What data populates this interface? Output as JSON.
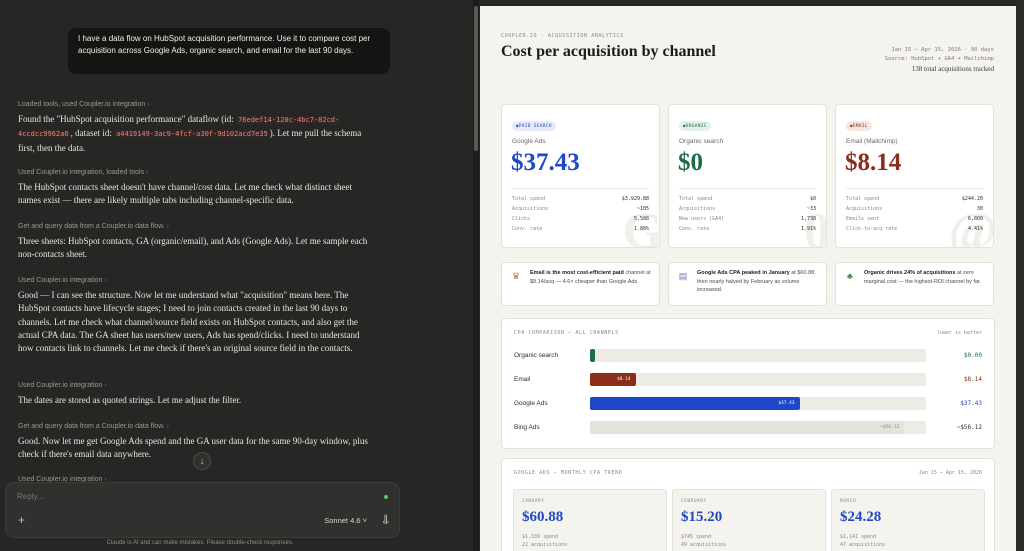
{
  "chat": {
    "user_message": "I have a data flow on HubSpot acquisition performance. Use it to compare cost per acquisition across Google Ads, organic search, and email for the last 90 days.",
    "step1": "Loaded tools, used Coupler.io integration",
    "para1_a": "Found the \"HubSpot acquisition performance\" dataflow (id: ",
    "para1_id": "76edef14-120c-4bc7-82cd-4ccdcc9962a6",
    "para1_b": ", dataset id: ",
    "para1_ds": "a4419149-3ac9-4fcf-a30f-9d102acd7e35",
    "para1_c": "). Let me pull the schema first, then the data.",
    "step2": "Used Coupler.io integration, loaded tools",
    "para2": "The HubSpot contacts sheet doesn't have channel/cost data. Let me check what distinct sheet names exist — there are likely multiple tabs including channel-specific data.",
    "step3": "Get and query data from a Coupler.io data flow.",
    "para3": "Three sheets: HubSpot contacts, GA (organic/email), and Ads (Google Ads). Let me sample each non-contacts sheet.",
    "step4": "Used Coupler.io integration",
    "para4": "Good — I can see the structure. Now let me understand what \"acquisition\" means here. The HubSpot contacts have lifecycle stages; I need to join contacts created in the last 90 days to channels. Let me check what channel/source field exists on HubSpot contacts, and also get the actual CPA data. The GA sheet has users/new users, Ads has spend/clicks. I need to understand how contacts link to channels. Let me check if there's an original source field in the contacts.",
    "step5": "Used Coupler.io integration",
    "para5": "The dates are stored as quoted strings. Let me adjust the filter.",
    "step6": "Get and query data from a Coupler.io data flow.",
    "para6": "Good. Now let me get Google Ads spend and the GA user data for the same 90-day window, plus check if there's email data anywhere.",
    "step7": "Used Coupler.io integration",
    "reply_placeholder": "Reply...",
    "plus": "+",
    "model": "Sonnet 4.6 ˅",
    "disclaimer": "Claude is AI and can make mistakes. Please double-check responses."
  },
  "report": {
    "kicker": "COUPLER.IO · ACQUISITION ANALYTICS",
    "title": "Cost per acquisition by channel",
    "date_range": "Jan 15 – Apr 15, 2026 · 90 days",
    "source": "Source: HubSpot + GA4 + Mailchimp",
    "total": "138 total acquisitions tracked",
    "cards": [
      {
        "badge": "PAID SEARCH",
        "name": "Google Ads",
        "cpa": "$37.43",
        "big": "G",
        "rows": [
          [
            "Total spend",
            "$3,929.88"
          ],
          [
            "Acquisitions",
            "~105"
          ],
          [
            "Clicks",
            "5,588"
          ],
          [
            "Conv. rate",
            "1.88%"
          ]
        ]
      },
      {
        "badge": "ORGANIC",
        "name": "Organic search",
        "cpa": "$0",
        "big": "0",
        "rows": [
          [
            "Total spend",
            "$0"
          ],
          [
            "Acquisitions",
            "~33"
          ],
          [
            "New users (GA4)",
            "1,738"
          ],
          [
            "Conv. rate",
            "1.91%"
          ]
        ]
      },
      {
        "badge": "EMAIL",
        "name": "Email (Mailchimp)",
        "cpa": "$8.14",
        "big": "@",
        "rows": [
          [
            "Total spend",
            "$244.20"
          ],
          [
            "Acquisitions",
            "30"
          ],
          [
            "Emails sent",
            "6,800"
          ],
          [
            "Click-to-acq rate",
            "4.41%"
          ]
        ]
      }
    ],
    "insights": [
      {
        "bold": "Email is the most cost-efficient paid",
        "text": " channel at $8.14/acq — 4.6× cheaper than Google Ads."
      },
      {
        "bold": "Google Ads CPA peaked in January",
        "text": " at $60.88, then nearly halved by February as volume increased."
      },
      {
        "bold": "Organic drives 24% of acquisitions",
        "text": " at zero marginal cost — the highest-ROI channel by far."
      }
    ],
    "comparison": {
      "title": "CPA COMPARISON — ALL CHANNELS",
      "note": "lower is better",
      "max": 60,
      "rows": [
        {
          "label": "Organic search",
          "value": 0.0,
          "bar_label": "",
          "display": "$0.00",
          "color": "#1e6b45"
        },
        {
          "label": "Email",
          "value": 8.14,
          "bar_label": "$8.14",
          "display": "$8.14",
          "color": "#8a2e1b"
        },
        {
          "label": "Google Ads",
          "value": 37.43,
          "bar_label": "$37.43",
          "display": "$37.43",
          "color": "#1f47c8"
        },
        {
          "label": "Bing Ads",
          "value": 56.12,
          "bar_label": "~$56.12",
          "display": "~$56.12",
          "color": "#e4e2dc"
        }
      ]
    },
    "trend": {
      "title": "GOOGLE ADS — MONTHLY CPA TREND",
      "range": "Jan 15 – Apr 15, 2026",
      "months": [
        {
          "name": "JANUARY",
          "cpa": "$60.88",
          "spend": "$1,339 spend",
          "acq": "22 acquisitions"
        },
        {
          "name": "FEBRUARY",
          "cpa": "$15.20",
          "spend": "$745 spend",
          "acq": "49 acquisitions"
        },
        {
          "name": "MARCH",
          "cpa": "$24.28",
          "spend": "$1,141 spend",
          "acq": "47 acquisitions"
        }
      ]
    }
  }
}
